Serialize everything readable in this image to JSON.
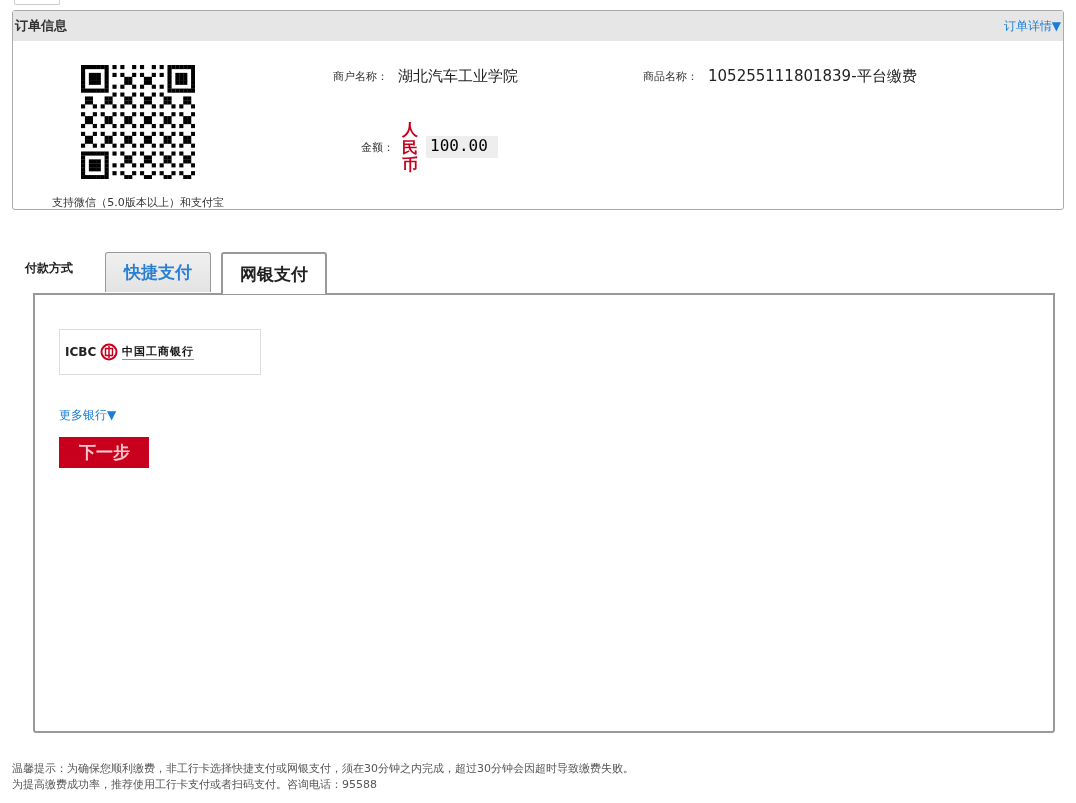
{
  "order_info": {
    "title": "订单信息",
    "details_link": "订单详情▼",
    "qr_caption": "支持微信（5.0版本以上）和支付宝",
    "merchant_label": "商户名称：",
    "merchant_name": "湖北汽车工业学院",
    "product_label": "商品名称：",
    "product_name": "105255111801839-平台缴费",
    "amount_label": "金额：",
    "currency": "人民币",
    "amount": "100.00"
  },
  "payment": {
    "label": "付款方式",
    "tabs": [
      {
        "label": "快捷支付",
        "selected": false
      },
      {
        "label": "网银支付",
        "selected": true
      }
    ],
    "bank": {
      "code": "ICBC",
      "name": "中国工商银行"
    },
    "more_banks": "更多银行▼",
    "next_button": "下一步"
  },
  "notice": [
    "温馨提示：为确保您顺利缴费，非工行卡选择快捷支付或网银支付，须在30分钟之内完成，超过30分钟会因超时导致缴费失败。",
    "为提高缴费成功率，推荐使用工行卡支付或者扫码支付。咨询电话：95588"
  ]
}
